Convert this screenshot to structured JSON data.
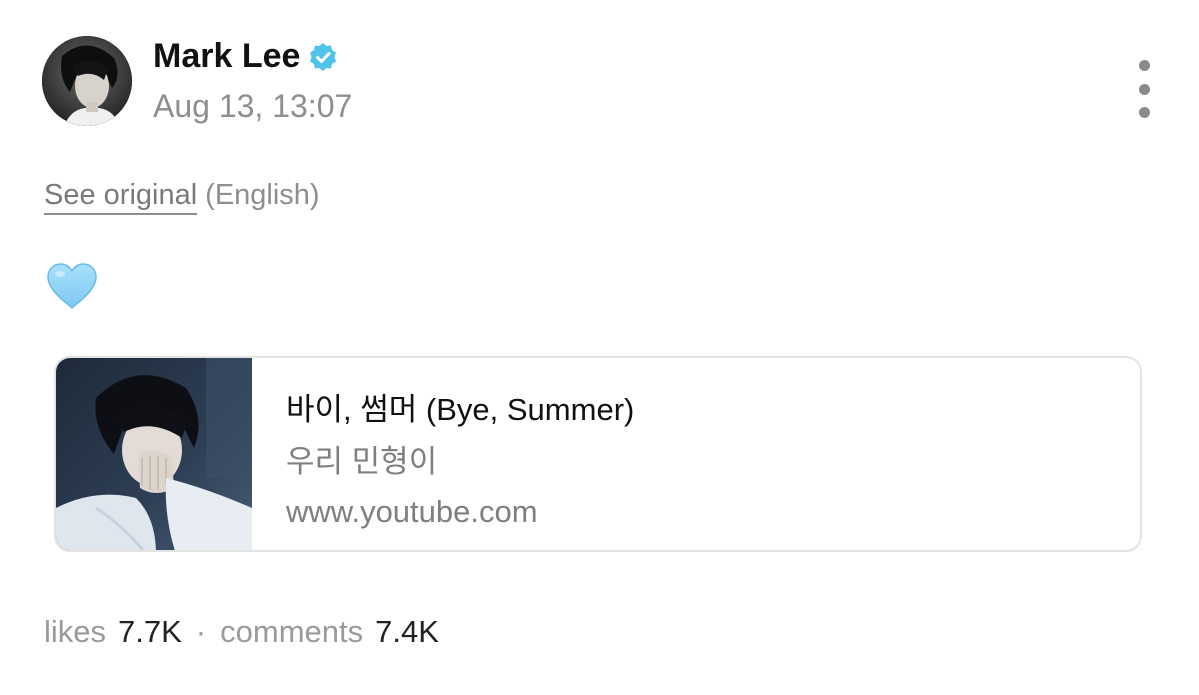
{
  "post": {
    "author": {
      "name": "Mark Lee",
      "verified": true,
      "verified_color": "#4fc3e8"
    },
    "timestamp": "Aug 13, 13:07",
    "translation": {
      "see_original_label": "See original",
      "language": "(English)"
    },
    "content_icon": "light-blue-heart-icon",
    "link_card": {
      "title": "바이, 썸머 (Bye, Summer)",
      "subtitle": "우리 민형이",
      "domain": "www.youtube.com"
    },
    "stats": {
      "likes_label": "likes",
      "likes_value": "7.7K",
      "separator": "·",
      "comments_label": "comments",
      "comments_value": "7.4K"
    }
  },
  "colors": {
    "secondary_text": "#8e8e8e",
    "heart": "#8fd3f7",
    "border": "#e3e3e3"
  }
}
